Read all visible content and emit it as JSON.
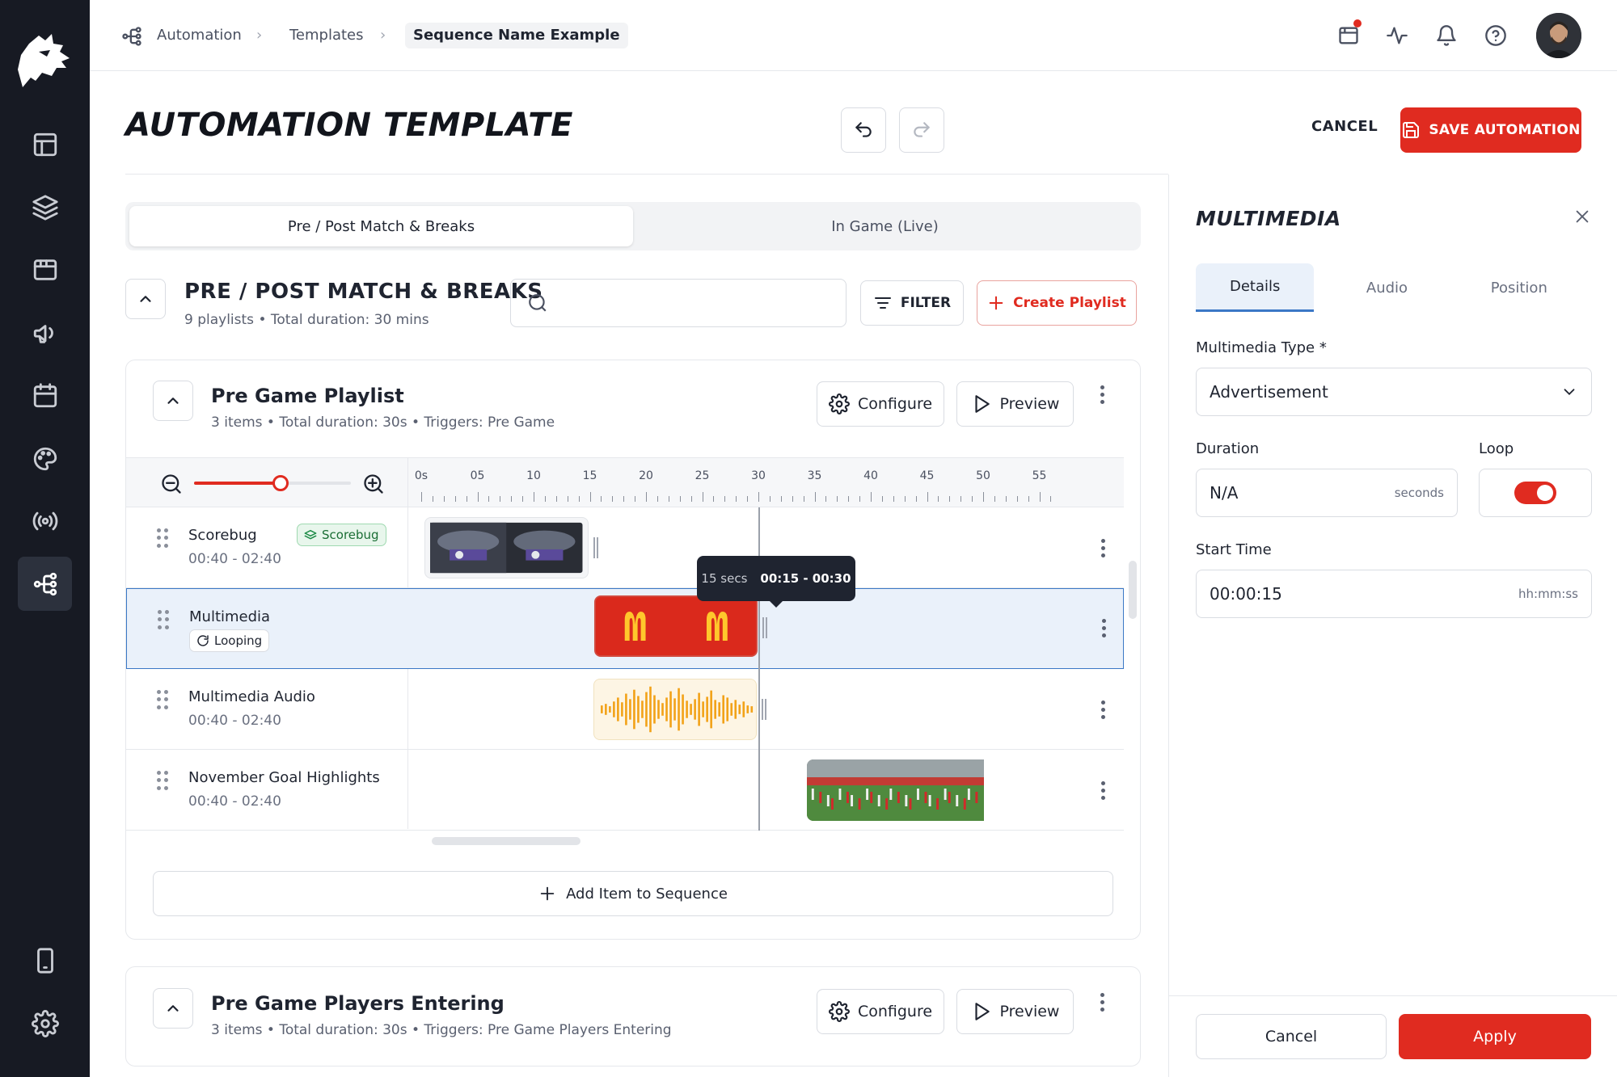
{
  "breadcrumb": {
    "items": [
      "Automation",
      "Templates",
      "Sequence Name Example"
    ]
  },
  "header": {
    "title": "AUTOMATION TEMPLATE",
    "cancel_label": "CANCEL",
    "save_label": "SAVE AUTOMATION"
  },
  "mode_tabs": [
    {
      "label": "Pre / Post Match & Breaks",
      "active": true
    },
    {
      "label": "In Game (Live)",
      "active": false
    }
  ],
  "section": {
    "title": "PRE / POST MATCH & BREAKS",
    "subtitle": "9 playlists • Total duration: 30 mins"
  },
  "search": {
    "value": "",
    "placeholder": ""
  },
  "filter_label": "FILTER",
  "create_label": "Create Playlist",
  "playlists": [
    {
      "title": "Pre Game Playlist",
      "subtitle": "3 items • Total duration: 30s • Triggers: Pre Game",
      "configure_label": "Configure",
      "preview_label": "Preview"
    },
    {
      "title": "Pre Game Players Entering",
      "subtitle": "3 items • Total duration: 30s • Triggers: Pre Game Players Entering",
      "configure_label": "Configure",
      "preview_label": "Preview"
    }
  ],
  "timeline": {
    "zoom_level": 0.55,
    "ticks": [
      "0s",
      "05",
      "10",
      "15",
      "20",
      "25",
      "30",
      "35",
      "40",
      "45",
      "50",
      "55"
    ],
    "playhead_seconds": 30,
    "tooltip": {
      "duration": "15 secs",
      "range": "00:15 - 00:30"
    },
    "rows": [
      {
        "name": "Scorebug",
        "time": "00:40 - 02:40",
        "tag": "Scorebug",
        "clip_start": 0,
        "clip_end": 15
      },
      {
        "name": "Multimedia",
        "tag": "Looping",
        "selected": true,
        "clip_start": 15,
        "clip_end": 30
      },
      {
        "name": "Multimedia Audio",
        "time": "00:40 - 02:40",
        "clip_start": 15,
        "clip_end": 30
      },
      {
        "name": "November Goal Highlights",
        "time": "00:40 - 02:40",
        "clip_start": 34,
        "clip_end": 56
      }
    ]
  },
  "add_item_label": "Add Item to Sequence",
  "panel": {
    "title": "MULTIMEDIA",
    "tabs": [
      {
        "label": "Details",
        "active": true
      },
      {
        "label": "Audio",
        "active": false
      },
      {
        "label": "Position",
        "active": false
      }
    ],
    "type_label": "Multimedia Type *",
    "type_value": "Advertisement",
    "duration_label": "Duration",
    "duration_value": "N/A",
    "duration_unit": "seconds",
    "loop_label": "Loop",
    "loop_on": true,
    "start_label": "Start Time",
    "start_value": "00:00:15",
    "start_format": "hh:mm:ss",
    "cancel_label": "Cancel",
    "apply_label": "Apply"
  },
  "colors": {
    "accent": "#e02b20",
    "nav_bg": "#171a23",
    "selection": "#3b78c6"
  }
}
